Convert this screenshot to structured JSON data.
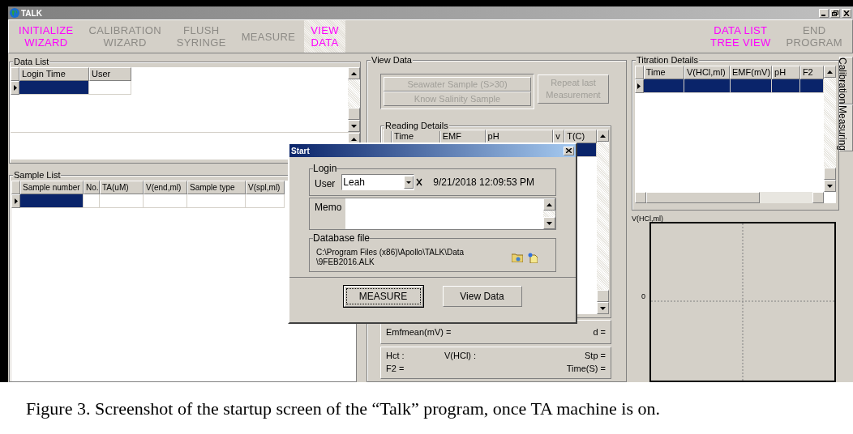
{
  "window": {
    "title": "TALK"
  },
  "toolbar": {
    "left": [
      {
        "label": "INITIALIZE\nWIZARD",
        "enabled": true,
        "selected": false
      },
      {
        "label": "CALIBRATION\nWIZARD",
        "enabled": false,
        "selected": false
      },
      {
        "label": "FLUSH\nSYRINGE",
        "enabled": false,
        "selected": false
      },
      {
        "label": "MEASURE",
        "enabled": false,
        "selected": false
      },
      {
        "label": "VIEW\nDATA",
        "enabled": true,
        "selected": true
      }
    ],
    "right": [
      {
        "label": "DATA LIST\nTREE VIEW",
        "enabled": true,
        "selected": false
      },
      {
        "label": "END\nPROGRAM",
        "enabled": false,
        "selected": false
      }
    ]
  },
  "data_list": {
    "title": "Data List",
    "columns": [
      "Login Time",
      "User"
    ],
    "rows": [
      {
        "selected": true
      }
    ]
  },
  "sample_list": {
    "title": "Sample List",
    "columns": [
      "Sample number",
      "No.",
      "TA(uM)",
      "V(end,ml)",
      "Sample type",
      "V(spl,ml)"
    ],
    "rows": [
      {
        "selected": true
      }
    ]
  },
  "view_data": {
    "title": "View Data",
    "sample_buttons": [
      {
        "label": "Seawater Sample (S>30)",
        "disabled": true
      },
      {
        "label": "Know Salinity Sample",
        "disabled": true
      }
    ],
    "repeat_button": {
      "label": "Repeat last\nMeasurement",
      "disabled": true
    },
    "reading_details": {
      "title": "Reading Details",
      "columns": [
        "Time",
        "EMF",
        "pH",
        "v",
        "T(C)"
      ],
      "rows": [
        {
          "selected": true
        }
      ]
    },
    "emfmean": "Emfmean(mV) =",
    "d": "d =",
    "stats": [
      "Hct :",
      "V(HCl) :",
      "Stp =",
      "F2 =",
      "Time(S) ="
    ]
  },
  "titration": {
    "title": "Titration Details",
    "columns": [
      "Time",
      "V(HCl,ml)",
      "EMF(mV)",
      "pH",
      "F2"
    ],
    "rows": [
      {
        "selected": true
      }
    ]
  },
  "plot": {
    "ylabel": "V(HCl,ml)",
    "ytick": "0"
  },
  "side_tabs": [
    {
      "label": "Calibration",
      "selected": false
    },
    {
      "label": "Measuring",
      "selected": true
    }
  ],
  "dialog": {
    "title": "Start",
    "login_title": "Login",
    "user_label": "User",
    "user_value": "Leah",
    "timestamp": "9/21/2018 12:09:53 PM",
    "memo_label": "Memo",
    "db_title": "Database file",
    "db_path": "C:\\Program Files (x86)\\Apollo\\TALK\\Data\n\\9FEB2016.ALK",
    "buttons": [
      {
        "label": "MEASURE",
        "default": true
      },
      {
        "label": "View Data",
        "default": false
      }
    ]
  },
  "caption": "Figure 3. Screenshot of the startup screen of the “Talk” program, once TA machine is on."
}
